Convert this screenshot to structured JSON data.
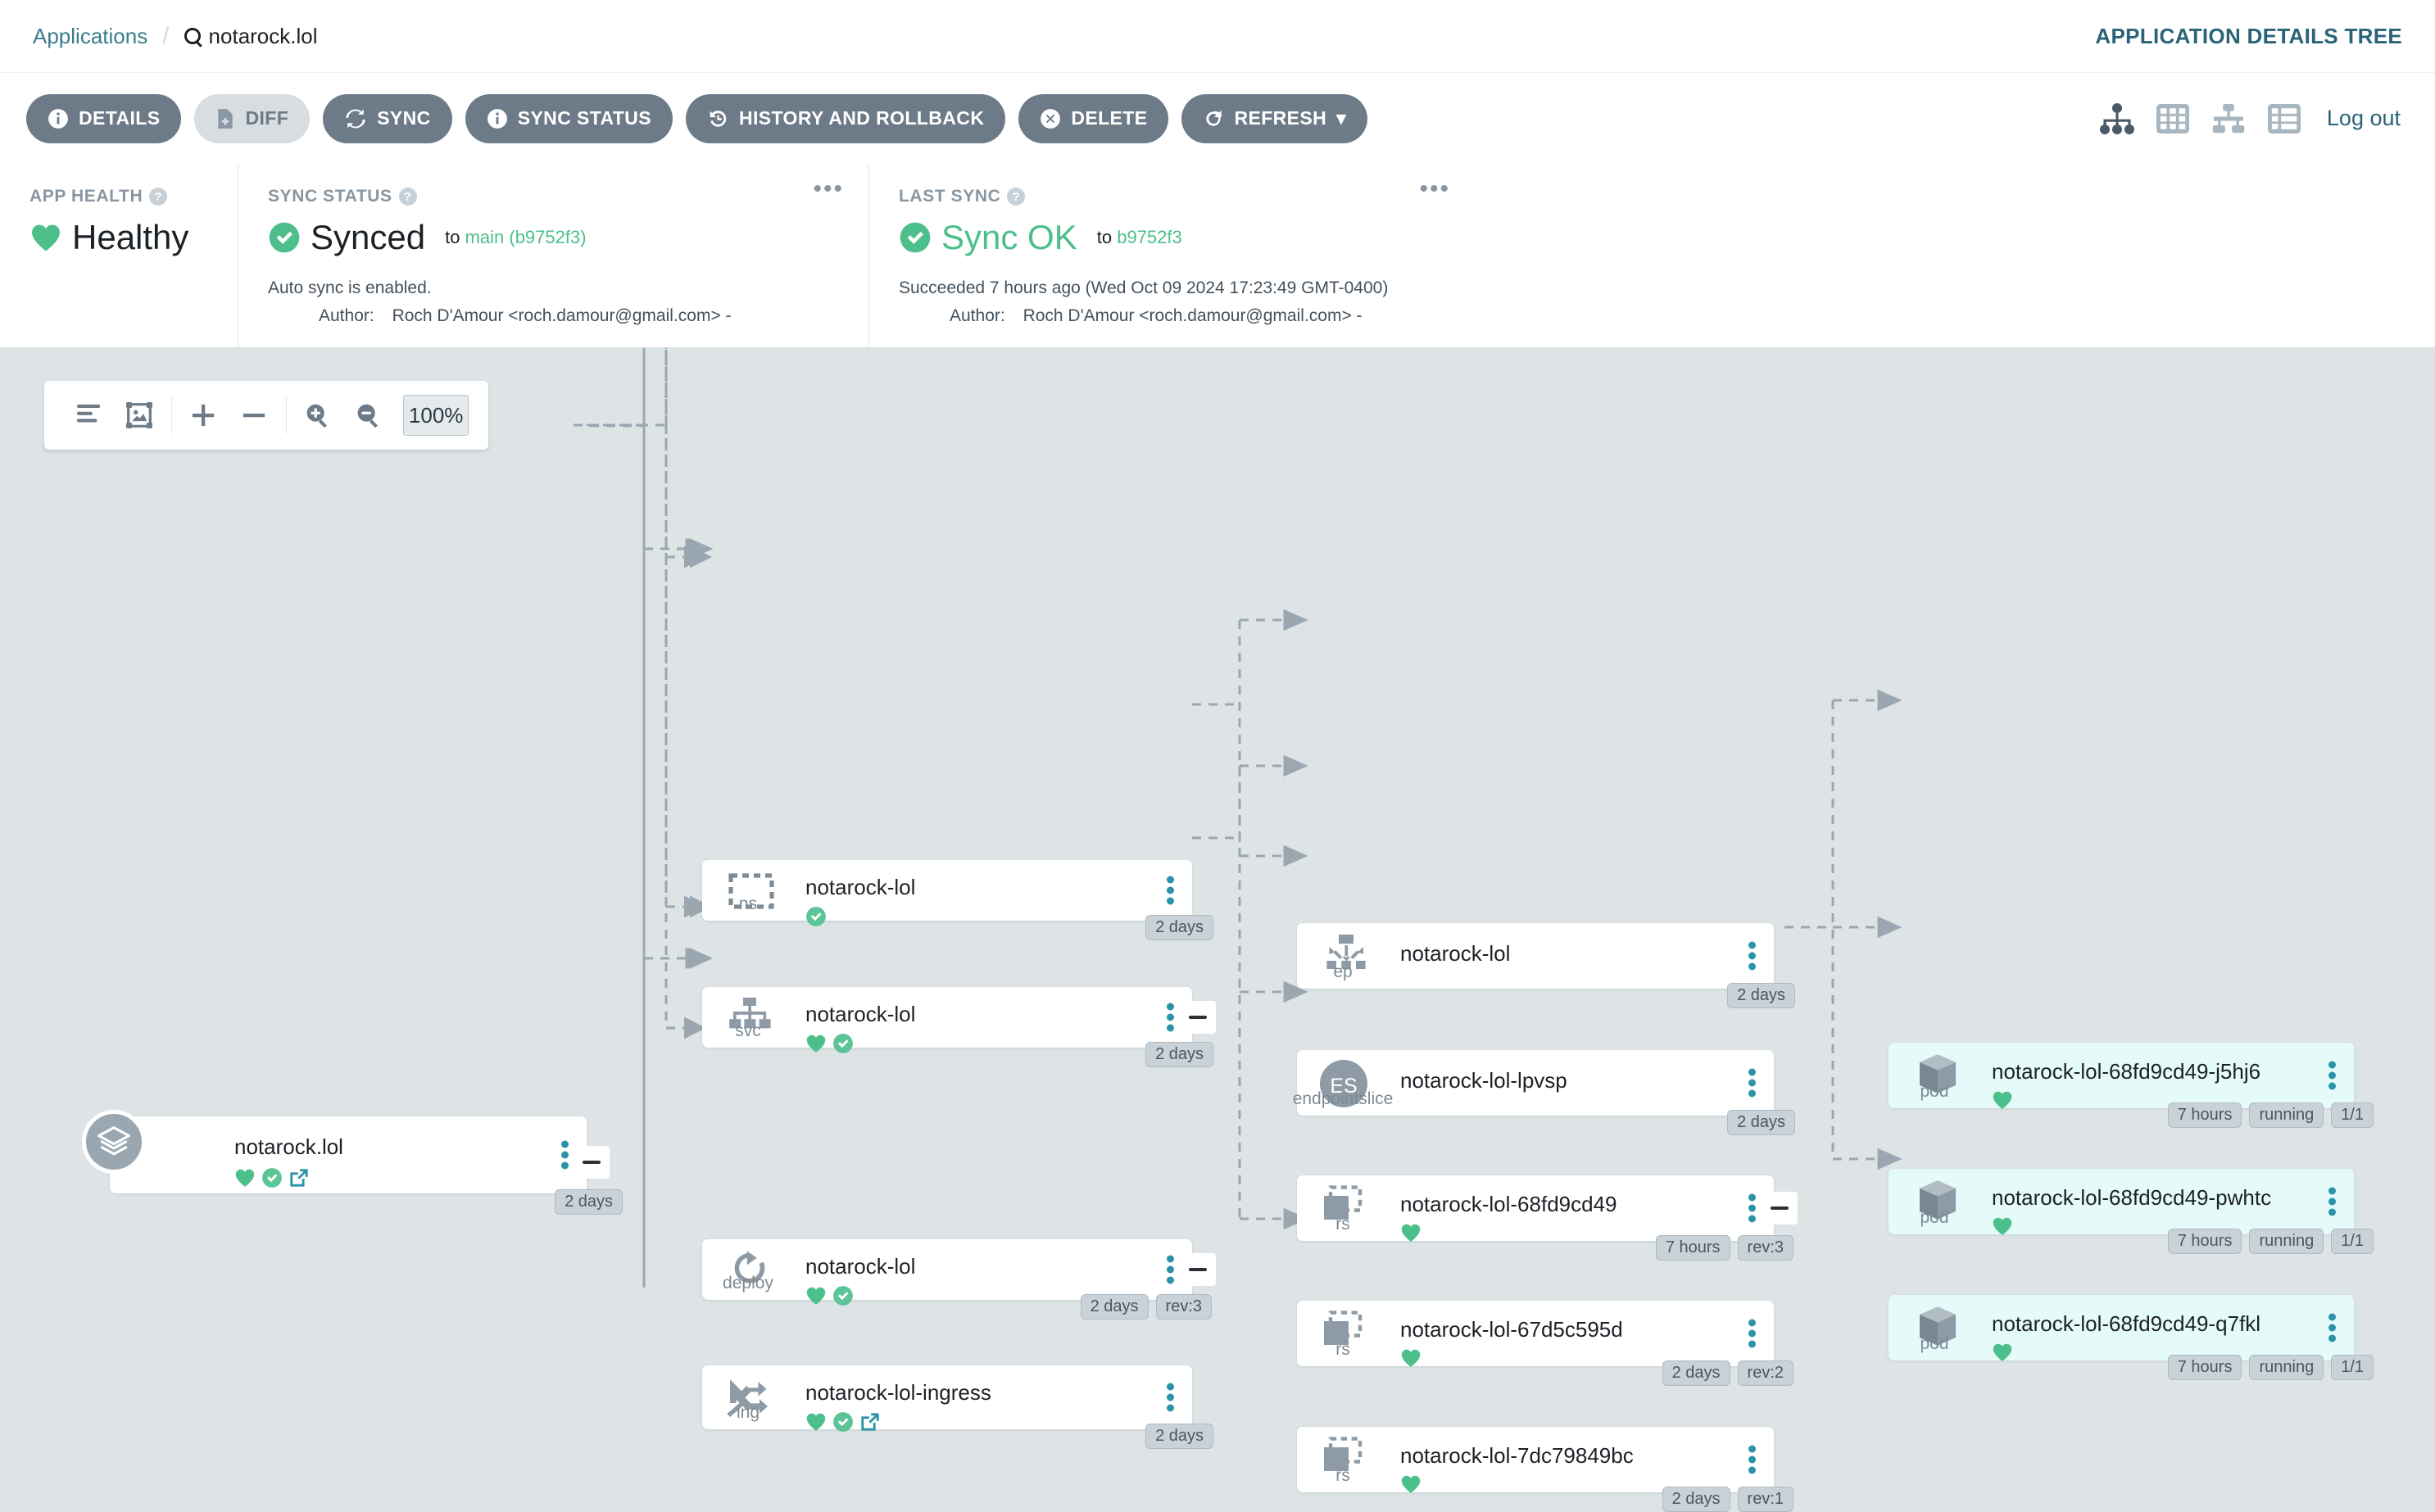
{
  "header": {
    "breadcrumb_root": "Applications",
    "breadcrumb_separator": "/",
    "app_name": "notarock.lol",
    "search_icon": "search-icon",
    "view_title": "APPLICATION DETAILS TREE",
    "logout_label": "Log out",
    "view_icons": [
      "tree-view-icon",
      "pods-grid-icon",
      "network-view-icon",
      "list-view-icon"
    ]
  },
  "toolbar": {
    "buttons": [
      {
        "label": "DETAILS",
        "icon": "info-icon",
        "state": "normal"
      },
      {
        "label": "DIFF",
        "icon": "file-diff-icon",
        "state": "muted"
      },
      {
        "label": "SYNC",
        "icon": "sync-icon",
        "state": "normal"
      },
      {
        "label": "SYNC STATUS",
        "icon": "info-icon",
        "state": "normal"
      },
      {
        "label": "HISTORY AND ROLLBACK",
        "icon": "history-icon",
        "state": "normal"
      },
      {
        "label": "DELETE",
        "icon": "delete-circle-icon",
        "state": "normal"
      },
      {
        "label": "REFRESH",
        "icon": "refresh-icon",
        "state": "normal",
        "caret": "▾"
      }
    ]
  },
  "status": {
    "app_health": {
      "label": "APP HEALTH",
      "value": "Healthy",
      "icon": "heart-icon",
      "color": "#4cbf8b"
    },
    "sync_status": {
      "label": "SYNC STATUS",
      "value": "Synced",
      "to_prefix": "to",
      "revision": "main (b9752f3)",
      "note": "Auto sync is enabled.",
      "author_label": "Author:",
      "author": "Roch D'Amour <roch.damour@gmail.com> -",
      "icon": "check-circle-icon",
      "menu_icon": "ellipsis-icon"
    },
    "last_sync": {
      "label": "LAST SYNC",
      "value": "Sync OK",
      "to_prefix": "to",
      "revision": "b9752f3",
      "note": "Succeeded 7 hours ago (Wed Oct 09 2024 17:23:49 GMT-0400)",
      "author_label": "Author:",
      "author": "Roch D'Amour <roch.damour@gmail.com> -",
      "icon": "check-circle-icon",
      "menu_icon": "ellipsis-icon"
    }
  },
  "zoombar": {
    "icons": [
      "align-left-icon",
      "fit-to-screen-icon",
      "plus-icon",
      "minus-icon",
      "zoom-in-icon",
      "zoom-out-icon"
    ],
    "zoom_value": "100%"
  },
  "tree": {
    "nodes": [
      {
        "id": "app",
        "kind": "",
        "name": "notarock.lol",
        "tags": [
          "2 days"
        ],
        "health": true,
        "synced": true,
        "extlink": true
      },
      {
        "id": "ns",
        "kind": "ns",
        "name": "notarock-lol",
        "tags": [
          "2 days"
        ],
        "health": false,
        "synced": true,
        "extlink": false
      },
      {
        "id": "svc",
        "kind": "svc",
        "name": "notarock-lol",
        "tags": [
          "2 days"
        ],
        "health": true,
        "synced": true,
        "extlink": false
      },
      {
        "id": "deploy",
        "kind": "deploy",
        "name": "notarock-lol",
        "tags": [
          "2 days",
          "rev:3"
        ],
        "health": true,
        "synced": true,
        "extlink": false
      },
      {
        "id": "ing",
        "kind": "ing",
        "name": "notarock-lol-ingress",
        "tags": [
          "2 days"
        ],
        "health": true,
        "synced": true,
        "extlink": true
      },
      {
        "id": "ep",
        "kind": "ep",
        "name": "notarock-lol",
        "tags": [
          "2 days"
        ],
        "health": false,
        "synced": false,
        "extlink": false
      },
      {
        "id": "endpointslice",
        "kind": "endpointslice",
        "name": "notarock-lol-lpvsp",
        "tags": [
          "2 days"
        ],
        "health": false,
        "synced": false,
        "extlink": false
      },
      {
        "id": "rs1",
        "kind": "rs",
        "name": "notarock-lol-68fd9cd49",
        "tags": [
          "7 hours",
          "rev:3"
        ],
        "health": true,
        "synced": false,
        "extlink": false
      },
      {
        "id": "rs2",
        "kind": "rs",
        "name": "notarock-lol-67d5c595d",
        "tags": [
          "2 days",
          "rev:2"
        ],
        "health": true,
        "synced": false,
        "extlink": false
      },
      {
        "id": "rs3",
        "kind": "rs",
        "name": "notarock-lol-7dc79849bc",
        "tags": [
          "2 days",
          "rev:1"
        ],
        "health": true,
        "synced": false,
        "extlink": false
      },
      {
        "id": "pod1",
        "kind": "pod",
        "name": "notarock-lol-68fd9cd49-j5hj6",
        "tags": [
          "7 hours",
          "running",
          "1/1"
        ],
        "health": true,
        "synced": false,
        "extlink": false
      },
      {
        "id": "pod2",
        "kind": "pod",
        "name": "notarock-lol-68fd9cd49-pwhtc",
        "tags": [
          "7 hours",
          "running",
          "1/1"
        ],
        "health": true,
        "synced": false,
        "extlink": false
      },
      {
        "id": "pod3",
        "kind": "pod",
        "name": "notarock-lol-68fd9cd49-q7fkl",
        "tags": [
          "7 hours",
          "running",
          "1/1"
        ],
        "health": true,
        "synced": false,
        "extlink": false
      }
    ]
  },
  "colors": {
    "canvas_bg": "#dee4e6",
    "healthy_green": "#4cbf8b",
    "accent_teal": "#2b93a8",
    "link_blue": "#2a6378",
    "button_gray": "#6d7b88",
    "pod_bg": "#e4fbfa"
  }
}
